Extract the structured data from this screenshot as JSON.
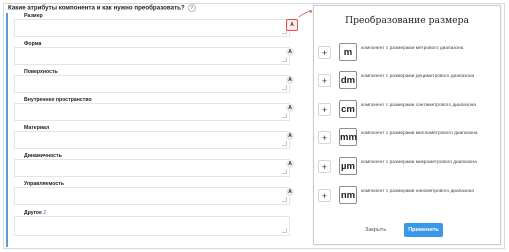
{
  "question": {
    "text": "Какие атрибуты компонента и как нужно преобразовать?",
    "help_icon": "?"
  },
  "fields": [
    {
      "label": "Размер",
      "a": "A",
      "active": true
    },
    {
      "label": "Форма",
      "a": "A"
    },
    {
      "label": "Поверхность",
      "a": "A"
    },
    {
      "label": "Внутреннее пространство",
      "a": "A"
    },
    {
      "label": "Материал",
      "a": "A"
    },
    {
      "label": "Динамичность",
      "a": "A"
    },
    {
      "label": "Управляемость",
      "a": "A"
    },
    {
      "label": "Другое",
      "mark": "2"
    }
  ],
  "panel": {
    "title": "Преобразование размера",
    "plus_label": "+",
    "units": [
      {
        "unit": "m",
        "desc": "компонент с размерами метрового диапазона"
      },
      {
        "unit": "dm",
        "desc": "компонент с размерами дециметрового диапазона"
      },
      {
        "unit": "cm",
        "desc": "компонент с размерами сантиметрового диапазона"
      },
      {
        "unit": "mm",
        "desc": "компонент с размерами миллиметрового диапазона"
      },
      {
        "unit": "µm",
        "desc": "компонент с размерами микрометрового диапазона"
      },
      {
        "unit": "nm",
        "desc": "компонент с размерами нанометрового диапазона"
      }
    ],
    "close_label": "Закрыть",
    "apply_label": "Применить"
  },
  "colors": {
    "accent": "#3b97e8",
    "active_border": "#e05050"
  }
}
